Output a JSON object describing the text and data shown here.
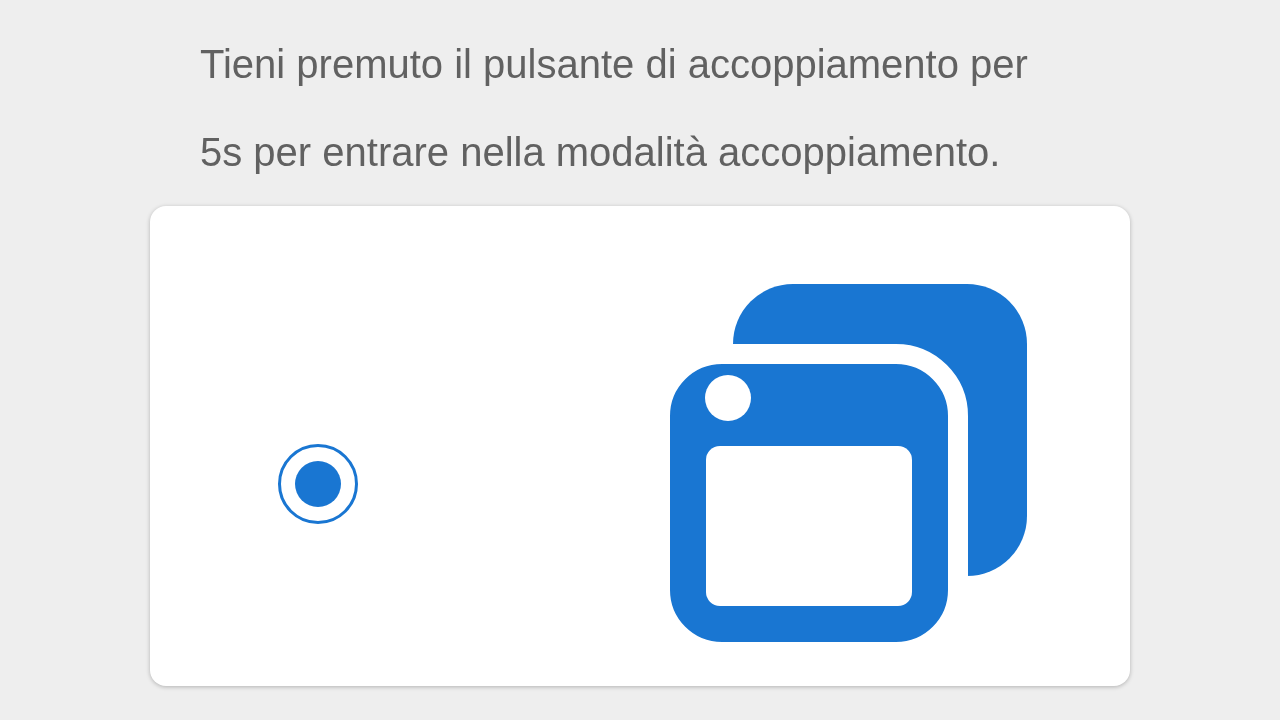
{
  "instruction": "Tieni premuto il pulsante di accoppiamento per 5s per entrare nella modalità accoppiamento.",
  "option": {
    "selected": true
  }
}
